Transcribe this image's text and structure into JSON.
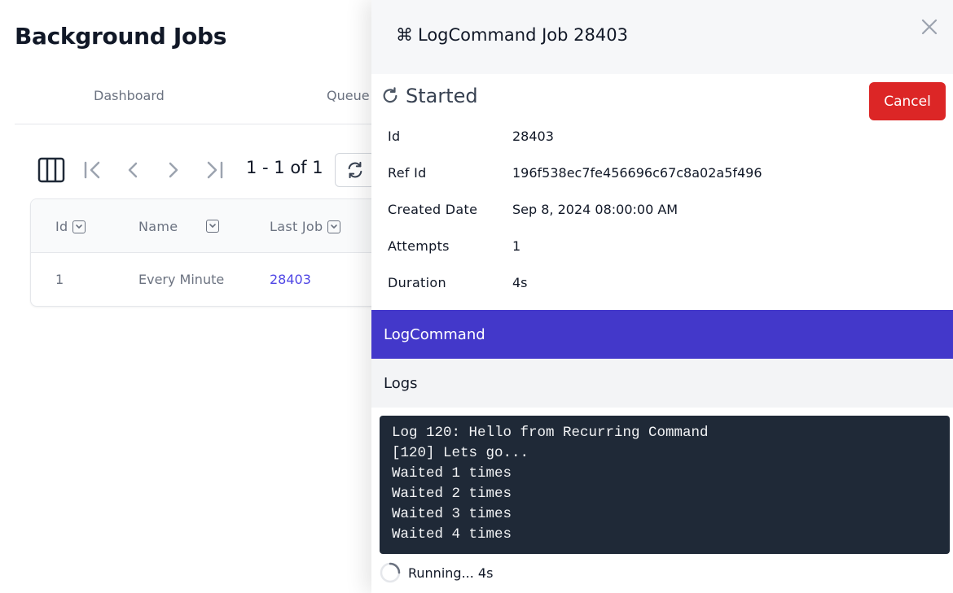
{
  "page": {
    "title": "Background Jobs",
    "tabs": [
      {
        "label": "Dashboard"
      },
      {
        "label": "Queue"
      }
    ]
  },
  "toolbar": {
    "pager_text": "1 - 1 of 1"
  },
  "table": {
    "columns": [
      "Id",
      "Name",
      "Last Job"
    ],
    "rows": [
      {
        "id": "1",
        "name": "Every Minute",
        "last_job": "28403"
      }
    ]
  },
  "panel": {
    "title_icon": "⌘",
    "title": "LogCommand Job 28403",
    "status": "Started",
    "cancel_label": "Cancel",
    "details": [
      {
        "key": "Id",
        "value": "28403"
      },
      {
        "key": "Ref Id",
        "value": "196f538ec7fe456696c67c8a02a5f496"
      },
      {
        "key": "Created Date",
        "value": "Sep 8, 2024 08:00:00 AM"
      },
      {
        "key": "Attempts",
        "value": "1"
      },
      {
        "key": "Duration",
        "value": "4s"
      }
    ],
    "command": "LogCommand",
    "logs_label": "Logs",
    "log_lines": [
      "Log 120: Hello from Recurring Command",
      "[120] Lets go...",
      "Waited 1 times",
      "Waited 2 times",
      "Waited 3 times",
      "Waited 4 times"
    ],
    "running_text": "Running... 4s"
  },
  "colors": {
    "cancel": "#dc2626",
    "command_bar": "#4338ca",
    "console_bg": "#1f2937",
    "link": "#4f46e5"
  }
}
